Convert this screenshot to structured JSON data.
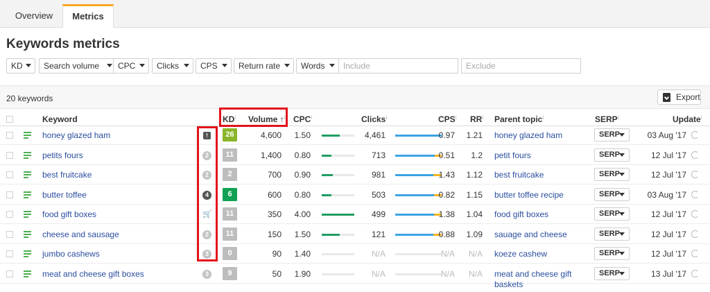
{
  "tabs": [
    "Overview",
    "Metrics"
  ],
  "page_title": "Keywords metrics",
  "filters": [
    "KD",
    "Search volume",
    "CPC",
    "Clicks",
    "CPS",
    "Return rate",
    "Words"
  ],
  "include_placeholder": "Include",
  "exclude_placeholder": "Exclude",
  "keyword_count": "20 keywords",
  "export_label": "Export",
  "columns": {
    "keyword": "Keyword",
    "kd": "KD",
    "volume": "Volume",
    "cpc": "CPC",
    "clicks": "Clicks",
    "cps": "CPS",
    "rr": "RR",
    "parent": "Parent topic",
    "serp": "SERP",
    "update": "Update"
  },
  "info_mark": "i",
  "sort_arrow": "↑",
  "serp_label": "SERP",
  "colors": {
    "kd_high": "#8ab52a",
    "kd_green": "#11a152",
    "kd_gray": "#bdbdbd",
    "cpc_bar": "#1f9d62",
    "clicks_bar": "#3aa3e3",
    "cps_bar_paid": "#f5b321",
    "highlight": "#e3111a",
    "link": "#2a4d9e"
  },
  "rows": [
    {
      "keyword": "honey glazed ham",
      "badge": "!",
      "badge_type": "sq",
      "kd": "26",
      "kd_color": "#8ab52a",
      "volume": "4,600",
      "cpc": "1.50",
      "cpc_level": 0.55,
      "clicks": "4,461",
      "clicks_fill": 1.0,
      "paid_fill": 0.0,
      "cps": "0.97",
      "rr": "1.21",
      "parent": "honey glazed ham",
      "update": "03 Aug '17"
    },
    {
      "keyword": "petits fours",
      "badge": "2",
      "badge_type": "circle",
      "kd": "11",
      "kd_color": "#bdbdbd",
      "volume": "1,400",
      "cpc": "0.80",
      "cpc_level": 0.3,
      "clicks": "713",
      "clicks_fill": 0.85,
      "paid_fill": 0.15,
      "cps": "0.51",
      "rr": "1.2",
      "parent": "petit fours",
      "update": "12 Jul '17"
    },
    {
      "keyword": "best fruitcake",
      "badge": "2",
      "badge_type": "circle",
      "kd": "2",
      "kd_color": "#bdbdbd",
      "volume": "700",
      "cpc": "0.90",
      "cpc_level": 0.34,
      "clicks": "981",
      "clicks_fill": 0.82,
      "paid_fill": 0.18,
      "cps": "1.43",
      "rr": "1.12",
      "parent": "best fruitcake",
      "update": "12 Jul '17"
    },
    {
      "keyword": "butter toffee",
      "badge": "4",
      "badge_type": "dark",
      "kd": "6",
      "kd_color": "#11a152",
      "volume": "600",
      "cpc": "0.80",
      "cpc_level": 0.3,
      "clicks": "503",
      "clicks_fill": 0.83,
      "paid_fill": 0.17,
      "cps": "0.82",
      "rr": "1.15",
      "parent": "butter toffee recipe",
      "update": "03 Aug '17"
    },
    {
      "keyword": "food gift boxes",
      "badge": "🛒",
      "badge_type": "cart",
      "kd": "11",
      "kd_color": "#bdbdbd",
      "volume": "350",
      "cpc": "4.00",
      "cpc_level": 1.0,
      "clicks": "499",
      "clicks_fill": 0.83,
      "paid_fill": 0.17,
      "cps": "1.38",
      "rr": "1.04",
      "parent": "food gift boxes",
      "update": "12 Jul '17"
    },
    {
      "keyword": "cheese and sausage",
      "badge": "2",
      "badge_type": "circle",
      "kd": "11",
      "kd_color": "#bdbdbd",
      "volume": "150",
      "cpc": "1.50",
      "cpc_level": 0.55,
      "clicks": "121",
      "clicks_fill": 0.82,
      "paid_fill": 0.18,
      "cps": "0.88",
      "rr": "1.09",
      "parent": "sauage and cheese",
      "update": "12 Jul '17"
    },
    {
      "keyword": "jumbo cashews",
      "badge": "3",
      "badge_type": "circle",
      "kd": "0",
      "kd_color": "#bdbdbd",
      "volume": "90",
      "cpc": "1.40",
      "cpc_level": 0.0,
      "clicks": "N/A",
      "clicks_fill": 0.0,
      "paid_fill": 0.0,
      "cps": "N/A",
      "rr": "N/A",
      "parent": "koeze cashew",
      "update": "12 Jul '17"
    },
    {
      "keyword": "meat and cheese gift boxes",
      "badge": "3",
      "badge_type": "circle",
      "kd": "9",
      "kd_color": "#bdbdbd",
      "volume": "50",
      "cpc": "1.90",
      "cpc_level": 0.0,
      "clicks": "N/A",
      "clicks_fill": 0.0,
      "paid_fill": 0.0,
      "cps": "N/A",
      "rr": "N/A",
      "parent": "meat and cheese gift baskets",
      "update": "13 Jul '17"
    }
  ]
}
